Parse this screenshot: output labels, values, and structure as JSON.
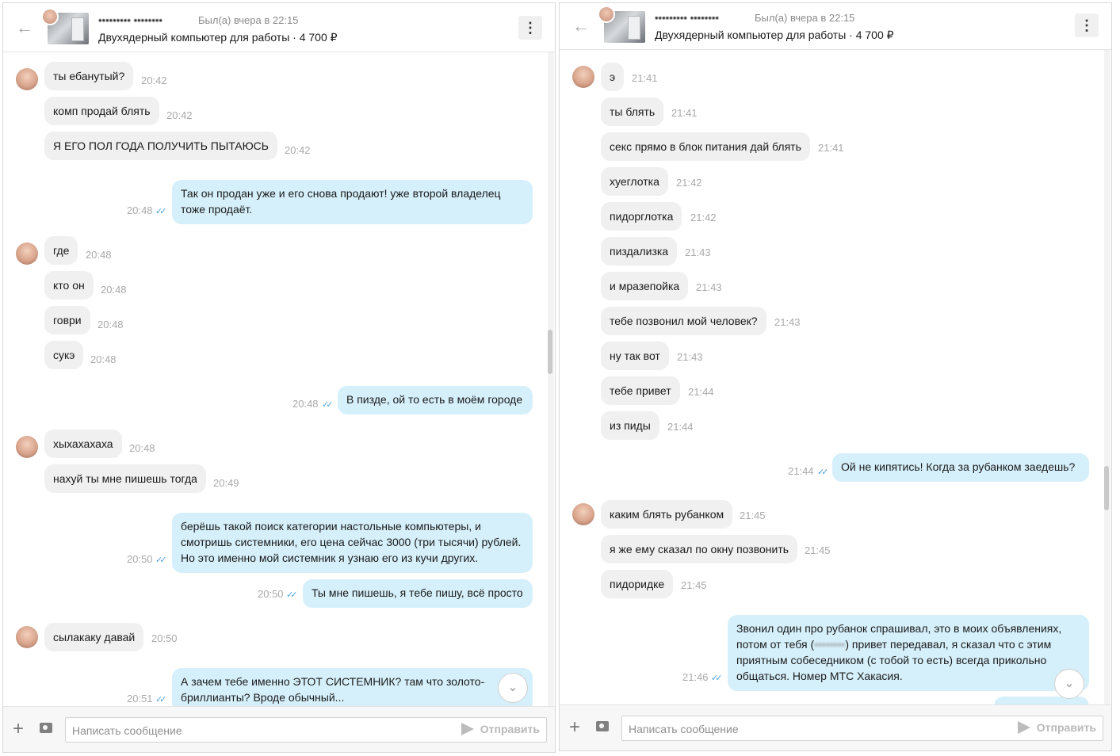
{
  "chat": {
    "user_name": "••••••••• ••••••••",
    "status": "Был(а) вчера в 22:15",
    "ad_title": "Двухядерный компьютер для работы · 4 700 ₽",
    "composer_placeholder": "Написать сообщение",
    "send_label": "Отправить"
  },
  "panel1": {
    "messages": [
      {
        "text": "ты ебанутый?",
        "time": "20:42"
      },
      {
        "text": "комп продай блять",
        "time": "20:42"
      },
      {
        "text": "Я ЕГО ПОЛ ГОДА ПОЛУЧИТЬ ПЫТАЮСЬ",
        "time": "20:42"
      },
      {
        "line1": "Так он продан уже и его снова продают! уже второй владелец",
        "line2": "тоже продаёт.",
        "time": "20:48"
      },
      {
        "text": "где",
        "time": "20:48"
      },
      {
        "text": "кто он",
        "time": "20:48"
      },
      {
        "text": "говри",
        "time": "20:48"
      },
      {
        "text": "сукэ",
        "time": "20:48"
      },
      {
        "text": "В пизде, ой то есть в моём городе",
        "time": "20:48"
      },
      {
        "text": "хыхахахаха",
        "time": "20:48"
      },
      {
        "text": "нахуй ты мне пишешь тогда",
        "time": "20:49"
      },
      {
        "line1": "берёшь такой поиск категории настольные компьютеры, и",
        "line2": "смотришь системники, его цена сейчас 3000 (три тысячи) рублей.",
        "line3": "Но это именно мой системник я узнаю его из кучи других.",
        "time": "20:50"
      },
      {
        "text": "Ты мне пишешь, я тебе пишу, всё просто",
        "time": "20:50"
      },
      {
        "text": "сылакаку давай",
        "time": "20:50"
      },
      {
        "line1": "А зачем тебе именно ЭТОТ СИСТЕМНИК? там что золото-",
        "line2": "бриллианты? Вроде обычный...",
        "time": "20:51"
      }
    ]
  },
  "panel2": {
    "messages": [
      {
        "text": "э",
        "time": "21:41"
      },
      {
        "text": "ты блять",
        "time": "21:41"
      },
      {
        "text": "секс прямо в блок питания дай блять",
        "time": "21:41"
      },
      {
        "text": "хуеглотка",
        "time": "21:42"
      },
      {
        "text": "пидорглотка",
        "time": "21:42"
      },
      {
        "text": "пиздализка",
        "time": "21:43"
      },
      {
        "text": "и мразепойка",
        "time": "21:43"
      },
      {
        "text": "тебе позвонил мой человек?",
        "time": "21:43"
      },
      {
        "text": "ну так вот",
        "time": "21:43"
      },
      {
        "text": "тебе привет",
        "time": "21:44"
      },
      {
        "text": "из пиды",
        "time": "21:44"
      },
      {
        "text": "Ой не кипятись! Когда  за рубанком заедешь?",
        "time": "21:44"
      },
      {
        "text": "каким блять рубанком",
        "time": "21:45"
      },
      {
        "text": "я же ему сказал по окну позвонить",
        "time": "21:45"
      },
      {
        "text": "пидоридке",
        "time": "21:45"
      },
      {
        "line1": "Звонил один про рубанок спрашивал, это в моих объявлениях,",
        "line2a": "потом от тебя (",
        "line2_hidden": "••••••••",
        "line2b": ") привет передавал, я сказал что с этим",
        "line3": "приятным собеседником (с тобой то есть) всегда прикольно",
        "line4": "общаться. Номер МТС Хакасия.",
        "time": "21:46"
      }
    ]
  },
  "icons": [
    "back-arrow-icon",
    "kebab-menu-icon",
    "plus-icon",
    "camera-icon",
    "send-icon",
    "chevron-down-icon",
    "double-check-icon"
  ],
  "colors": {
    "incoming_bubble": "#f0f0f0",
    "outgoing_bubble": "#d6f0fb",
    "read_ticks": "#4aa0d8"
  }
}
